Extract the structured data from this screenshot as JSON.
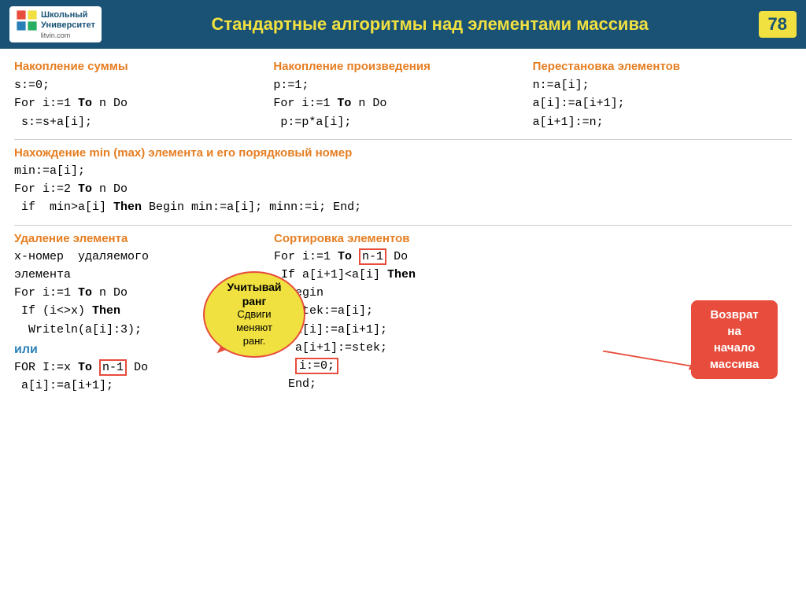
{
  "header": {
    "title": "Стандартные алгоритмы над элементами массива",
    "page_number": "78",
    "logo_line1": "Школьный",
    "logo_line2": "Университет",
    "logo_url": "litvin.com"
  },
  "top_columns": [
    {
      "title": "Накопление суммы",
      "code": [
        "s:=0;",
        "For i:=1 To n Do",
        " s:=s+a[i];"
      ]
    },
    {
      "title": "Накопление произведения",
      "code": [
        "p:=1;",
        "For i:=1 To n Do",
        " p:=p*a[i];"
      ]
    },
    {
      "title": "Перестановка элементов",
      "code": [
        "n:=a[i];",
        "a[i]:=a[i+1];",
        "a[i+1]:=n;"
      ]
    }
  ],
  "min_section": {
    "title": "Нахождение  min (max) элемента и его порядковый номер",
    "code": [
      "min:=a[i];",
      "For i:=2 To n Do",
      " if  min>a[i] Then Begin min:=a[i]; minn:=i; End;"
    ]
  },
  "bottom_left": {
    "title": "Удаление элемента",
    "code": [
      "x-номер  удаляемого",
      "элемента",
      "For i:=1 To n Do",
      " If (i<>x) Then",
      "  Writeln(a[i]:3);"
    ],
    "ili": "или",
    "code2": [
      "FOR I:=x To n-1 Do",
      " a[i]:=a[i+1];"
    ]
  },
  "bottom_right": {
    "title": "Сортировка элементов",
    "code": [
      "For i:=1 To n-1 Do",
      " If a[i+1]<a[i] Then",
      "  Begin",
      "   stek:=a[i];",
      "   a[i]:=a[i+1];",
      "   a[i+1]:=stek;",
      "   i:=0;",
      "  End;"
    ]
  },
  "callout": {
    "line1": "Учитывай",
    "line2": "ранг",
    "line3": "Сдвиги",
    "line4": "меняют",
    "line5": "ранг."
  },
  "return_bubble": {
    "line1": "Возврат",
    "line2": "на",
    "line3": "начало",
    "line4": "массива"
  }
}
